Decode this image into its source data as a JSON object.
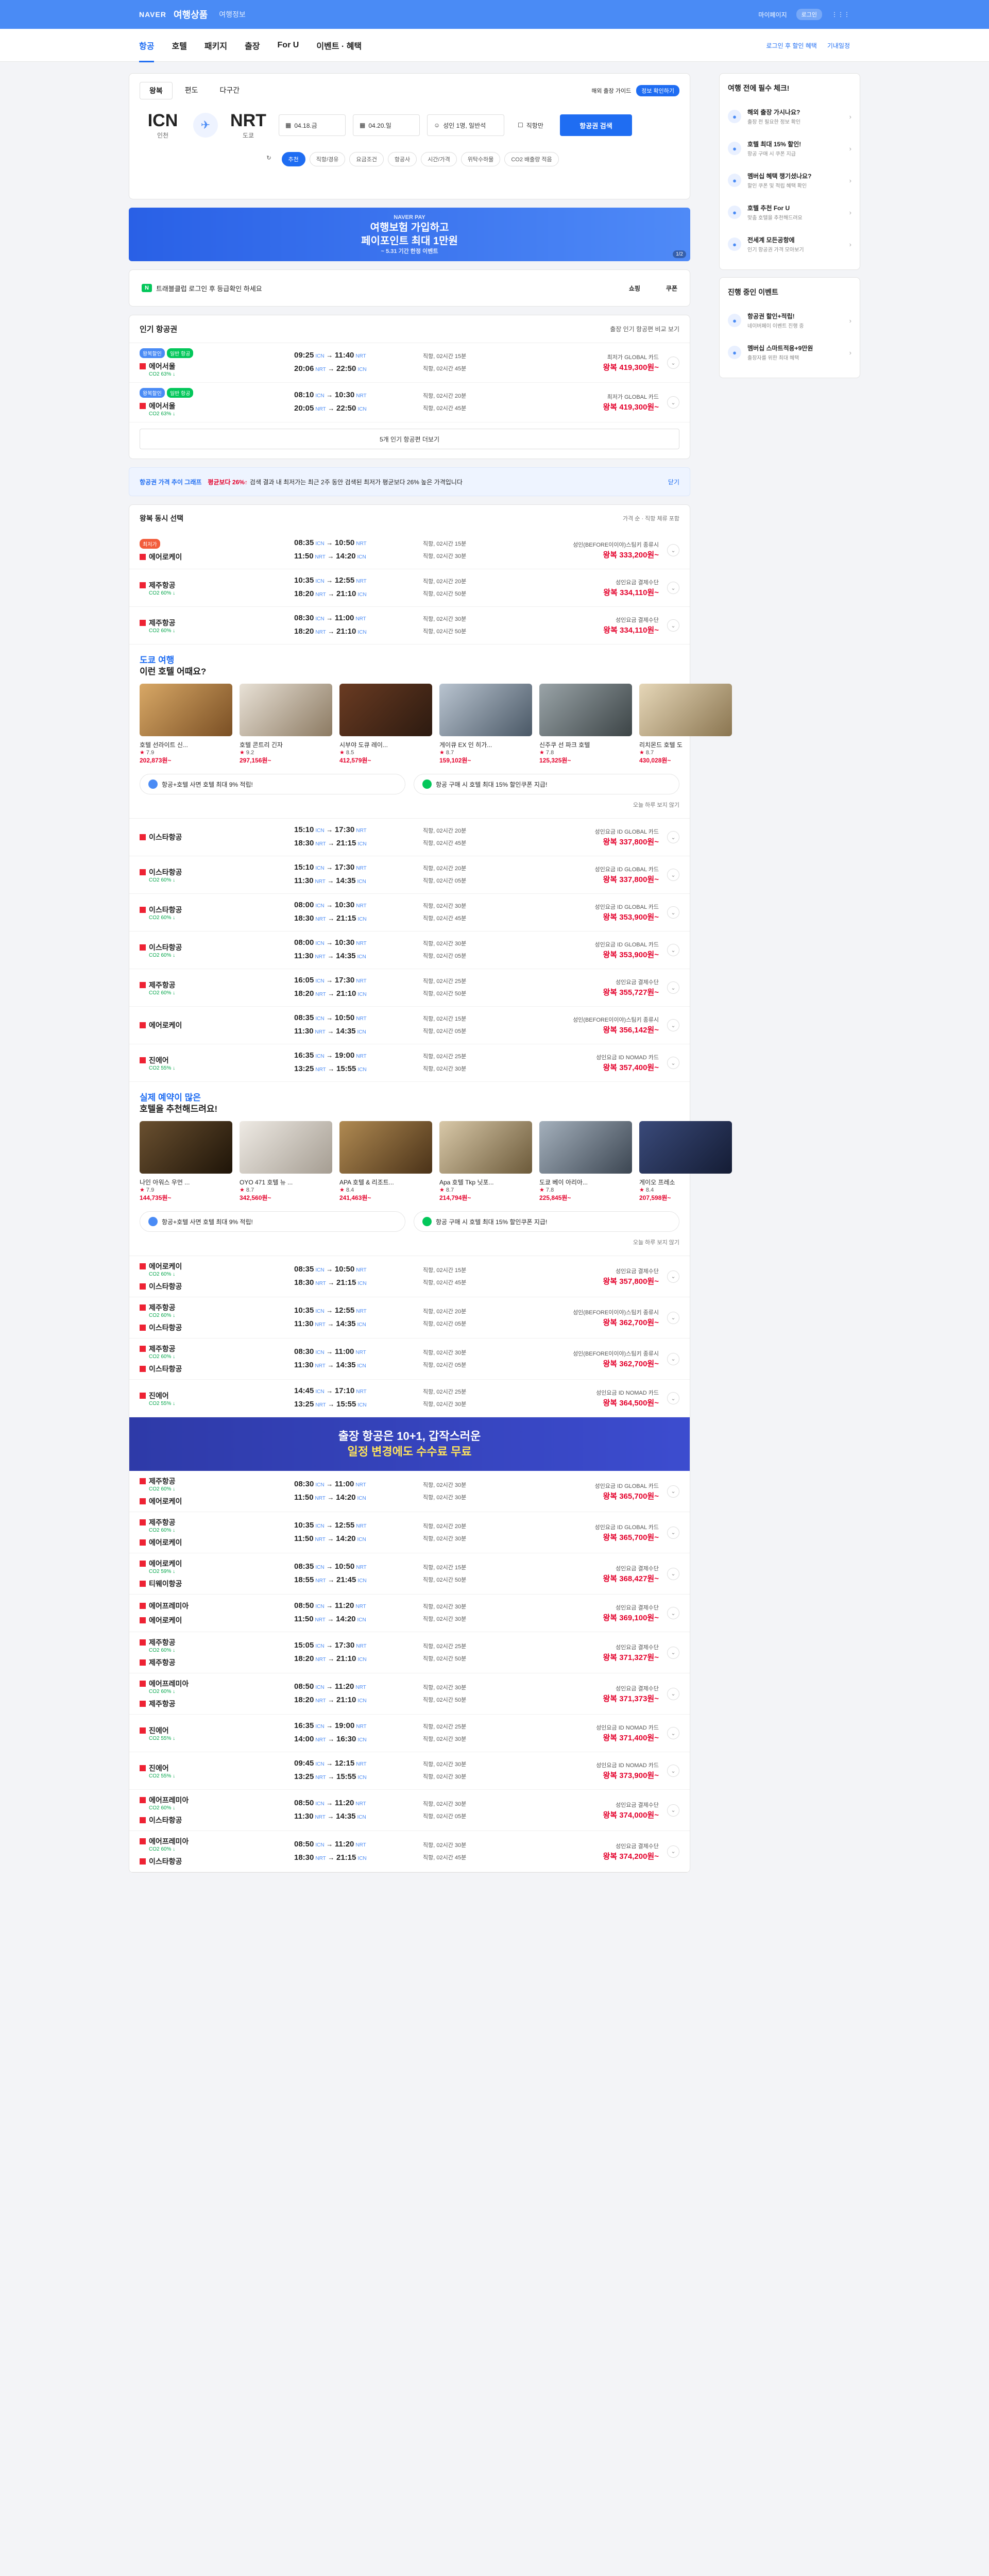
{
  "topbar": {
    "logo": "NAVER",
    "brand": "여행상품",
    "sub": "여행정보",
    "mypage": "마이페이지",
    "pill": "로그인"
  },
  "nav": {
    "tabs": [
      "항공",
      "호텔",
      "패키지",
      "출장",
      "For U",
      "이벤트 · 혜택"
    ],
    "login_note": "로그인 후 할인 혜택",
    "notice": "기내일정"
  },
  "search": {
    "trip_tabs": [
      "왕복",
      "편도",
      "다구간"
    ],
    "overseas": "해외 출장 가이드",
    "overseas_badge": "정보 확인하기",
    "from": {
      "code": "ICN",
      "city": "인천"
    },
    "to": {
      "code": "NRT",
      "city": "도쿄"
    },
    "date1": "04.18.금",
    "date2": "04.20.일",
    "pax": "성인 1명, 일반석",
    "direct": "직항만",
    "button": "항공권 검색",
    "filters": [
      "추천",
      "직항/경유",
      "요금조건",
      "항공사",
      "시간/가격",
      "위탁수하물",
      "CO2 배출량 적음"
    ]
  },
  "banner": {
    "eyebrow": "NAVER PAY",
    "title1": "여행보험 가입하고",
    "title2": "페이포인트 최대 1만원",
    "small": "~ 5.31 기간 한정 이벤트",
    "page": "1/2"
  },
  "promo": {
    "badge": "N",
    "text": "트래블클럽 로그인 후 등급확인 하세요",
    "shop": "쇼핑",
    "coupon": "쿠폰"
  },
  "popular": {
    "title": "인기 항공권",
    "more": "출장 인기 항공편 비교 보기",
    "more_btn": "5개 인기 항공편 더보기"
  },
  "popular_flights": [
    {
      "tags": [
        "왕복할인",
        "일반 항공"
      ],
      "air": "에어서울",
      "co2": "CO2 63% ↓",
      "t1": "09:25",
      "t1e": "11:40",
      "t2": "20:06",
      "t2e": "22:50",
      "d1": "직항, 02시간 15분",
      "d2": "직항, 02시간 45분",
      "seller": "최저가 GLOBAL 카드",
      "price": "왕복 419,300원~"
    },
    {
      "tags": [
        "왕복할인",
        "일반 항공"
      ],
      "air": "에어서울",
      "co2": "CO2 63% ↓",
      "t1": "08:10",
      "t1e": "10:30",
      "t2": "20:05",
      "t2e": "22:50",
      "d1": "직항, 02시간 20분",
      "d2": "직항, 02시간 45분",
      "seller": "최저가 GLOBAL 카드",
      "price": "왕복 419,300원~"
    }
  ],
  "notice": {
    "title": "항공권 가격 추이 그래프",
    "up": "평균보다 26%↑",
    "text": "검색 결과 내 최저가는 최근 2주 동안 검색된 최저가 평균보다 26% 높은 가격입니다",
    "btn": "닫기"
  },
  "sort": {
    "title": "왕복 동시 선택",
    "right": "가격 순 · 직항 체류 포함"
  },
  "flights_a": [
    {
      "best": "최저가",
      "air": "에어로케이",
      "air2": "",
      "co2": "",
      "t1": "08:35",
      "t1e": "10:50",
      "t2": "11:50",
      "t2e": "14:20",
      "d1": "직항, 02시간 15분",
      "d2": "직항, 02시간 30분",
      "seller": "성인(BEFORE이이야)스팀키 종류시",
      "price": "왕복 333,200원~"
    },
    {
      "best": "",
      "air": "제주항공",
      "air2": "",
      "co2": "CO2 60% ↓",
      "t1": "10:35",
      "t1e": "12:55",
      "t2": "18:20",
      "t2e": "21:10",
      "d1": "직항, 02시간 20분",
      "d2": "직항, 02시간 50분",
      "seller": "성인요금 결제수단",
      "price": "왕복 334,110원~"
    },
    {
      "best": "",
      "air": "제주항공",
      "air2": "",
      "co2": "CO2 60% ↓",
      "t1": "08:30",
      "t1e": "11:00",
      "t2": "18:20",
      "t2e": "21:10",
      "d1": "직항, 02시간 30분",
      "d2": "직항, 02시간 50분",
      "seller": "성인요금 결제수단",
      "price": "왕복 334,110원~"
    }
  ],
  "hotels1": {
    "title1": "도쿄 여행",
    "title2": "이런 호텔 어때요?",
    "items": [
      {
        "name": "호텔 선라이트 신...",
        "rating": "7.9",
        "price": "202,873원~"
      },
      {
        "name": "호텔 콘트리 긴자",
        "rating": "9.2",
        "price": "297,156원~"
      },
      {
        "name": "시부야 도큐 레이...",
        "rating": "8.5",
        "price": "412,579원~"
      },
      {
        "name": "게이큐 EX 인 히가...",
        "rating": "8.7",
        "price": "159,102원~"
      },
      {
        "name": "신주쿠 선 파크 호텔",
        "rating": "7.8",
        "price": "125,325원~"
      },
      {
        "name": "리치몬드 호텔 도",
        "rating": "8.7",
        "price": "430,028원~"
      }
    ]
  },
  "hbanner": {
    "b1": "항공+호텔 사면 호텔 최대 9% 적립!",
    "b2": "항공 구매 시 호텔 최대 15% 할인쿠폰 지급!",
    "hide": "오늘 하루 보지 않기"
  },
  "flights_b": [
    {
      "air": "이스타항공",
      "co2": "",
      "t1": "15:10",
      "t1e": "17:30",
      "t2": "18:30",
      "t2e": "21:15",
      "d1": "직항, 02시간 20분",
      "d2": "직항, 02시간 45분",
      "seller": "성인요금 ID GLOBAL 카드",
      "price": "왕복 337,800원~"
    },
    {
      "air": "이스타항공",
      "co2": "CO2 60% ↓",
      "t1": "15:10",
      "t1e": "17:30",
      "t2": "11:30",
      "t2e": "14:35",
      "d1": "직항, 02시간 20분",
      "d2": "직항, 02시간 05분",
      "seller": "성인요금 ID GLOBAL 카드",
      "price": "왕복 337,800원~"
    },
    {
      "air": "이스타항공",
      "co2": "CO2 60% ↓",
      "t1": "08:00",
      "t1e": "10:30",
      "t2": "18:30",
      "t2e": "21:15",
      "d1": "직항, 02시간 30분",
      "d2": "직항, 02시간 45분",
      "seller": "성인요금 ID GLOBAL 카드",
      "price": "왕복 353,900원~"
    },
    {
      "air": "이스타항공",
      "co2": "CO2 60% ↓",
      "t1": "08:00",
      "t1e": "10:30",
      "t2": "11:30",
      "t2e": "14:35",
      "d1": "직항, 02시간 30분",
      "d2": "직항, 02시간 05분",
      "seller": "성인요금 ID GLOBAL 카드",
      "price": "왕복 353,900원~"
    },
    {
      "air": "제주항공",
      "co2": "CO2 60% ↓",
      "t1": "16:05",
      "t1e": "17:30",
      "t2": "18:20",
      "t2e": "21:10",
      "d1": "직항, 02시간 25분",
      "d2": "직항, 02시간 50분",
      "seller": "성인요금 결제수단",
      "price": "왕복 355,727원~"
    },
    {
      "air": "에어로케이",
      "co2": "",
      "t1": "08:35",
      "t1e": "10:50",
      "t2": "11:30",
      "t2e": "14:35",
      "d1": "직항, 02시간 15분",
      "d2": "직항, 02시간 05분",
      "seller": "성인(BEFORE이이야)스팀키 종류시",
      "price": "왕복 356,142원~"
    },
    {
      "air": "진에어",
      "co2": "CO2 55% ↓",
      "t1": "16:35",
      "t1e": "19:00",
      "t2": "13:25",
      "t2e": "15:55",
      "d1": "직항, 02시간 25분",
      "d2": "직항, 02시간 30분",
      "seller": "성인요금 ID NOMAD 카드",
      "price": "왕복 357,400원~"
    }
  ],
  "hotels2": {
    "title1": "실제 예약이 많은",
    "title2": "호텔을 추천해드려요!",
    "items": [
      {
        "name": "나인 아워스 우먼 ...",
        "rating": "7.9",
        "price": "144,735원~"
      },
      {
        "name": "OYO 471 호텔 뉴 ...",
        "rating": "8.7",
        "price": "342,560원~"
      },
      {
        "name": "APA 호텔 & 리조트...",
        "rating": "8.4",
        "price": "241,463원~"
      },
      {
        "name": "Apa 호텔 Tkp 닛포...",
        "rating": "8.7",
        "price": "214,794원~"
      },
      {
        "name": "도쿄 베이 아리아...",
        "rating": "7.8",
        "price": "225,845원~"
      },
      {
        "name": "게이오 프레소",
        "rating": "8.4",
        "price": "207,598원~"
      }
    ]
  },
  "flights_c": [
    {
      "air": "에어로케이",
      "air2": "이스타항공",
      "co2": "CO2 60% ↓",
      "t1": "08:35",
      "t1e": "10:50",
      "t2": "18:30",
      "t2e": "21:15",
      "d1": "직항, 02시간 15분",
      "d2": "직항, 02시간 45분",
      "seller": "성인요금 결제수단",
      "price": "왕복 357,800원~"
    },
    {
      "air": "제주항공",
      "air2": "이스타항공",
      "co2": "CO2 60% ↓",
      "t1": "10:35",
      "t1e": "12:55",
      "t2": "11:30",
      "t2e": "14:35",
      "d1": "직항, 02시간 20분",
      "d2": "직항, 02시간 05분",
      "seller": "성인(BEFORE이이야)스팀키 종류시",
      "price": "왕복 362,700원~"
    },
    {
      "air": "제주항공",
      "air2": "이스타항공",
      "co2": "CO2 60% ↓",
      "t1": "08:30",
      "t1e": "11:00",
      "t2": "11:30",
      "t2e": "14:35",
      "d1": "직항, 02시간 30분",
      "d2": "직항, 02시간 05분",
      "seller": "성인(BEFORE이이야)스팀키 종류시",
      "price": "왕복 362,700원~"
    },
    {
      "air": "진에어",
      "air2": "",
      "co2": "CO2 55% ↓",
      "t1": "14:45",
      "t1e": "17:10",
      "t2": "13:25",
      "t2e": "15:55",
      "d1": "직항, 02시간 25분",
      "d2": "직항, 02시간 30분",
      "seller": "성인요금 ID NOMAD 카드",
      "price": "왕복 364,500원~"
    }
  ],
  "ad": {
    "line1": "출장 항공은 10+1, 갑작스러운",
    "line2": "일정 변경에도 수수료 무료"
  },
  "flights_d": [
    {
      "air": "제주항공",
      "air2": "에어로케이",
      "co2": "CO2 60% ↓",
      "t1": "08:30",
      "t1e": "11:00",
      "t2": "11:50",
      "t2e": "14:20",
      "d1": "직항, 02시간 30분",
      "d2": "직항, 02시간 30분",
      "seller": "성인요금 ID GLOBAL 카드",
      "price": "왕복 365,700원~"
    },
    {
      "air": "제주항공",
      "air2": "에어로케이",
      "co2": "CO2 60% ↓",
      "t1": "10:35",
      "t1e": "12:55",
      "t2": "11:50",
      "t2e": "14:20",
      "d1": "직항, 02시간 20분",
      "d2": "직항, 02시간 30분",
      "seller": "성인요금 ID GLOBAL 카드",
      "price": "왕복 365,700원~"
    },
    {
      "air": "에어로케이",
      "air2": "티웨이항공",
      "co2": "CO2 59% ↓",
      "t1": "08:35",
      "t1e": "10:50",
      "t2": "18:55",
      "t2e": "21:45",
      "d1": "직항, 02시간 15분",
      "d2": "직항, 02시간 50분",
      "seller": "성인요금 결제수단",
      "price": "왕복 368,427원~"
    },
    {
      "air": "에어프레미아",
      "air2": "에어로케이",
      "co2": "",
      "t1": "08:50",
      "t1e": "11:20",
      "t2": "11:50",
      "t2e": "14:20",
      "d1": "직항, 02시간 30분",
      "d2": "직항, 02시간 30분",
      "seller": "성인요금 결제수단",
      "price": "왕복 369,100원~"
    },
    {
      "air": "제주항공",
      "air2": "제주항공",
      "co2": "CO2 60% ↓",
      "t1": "15:05",
      "t1e": "17:30",
      "t2": "18:20",
      "t2e": "21:10",
      "d1": "직항, 02시간 25분",
      "d2": "직항, 02시간 50분",
      "seller": "성인요금 결제수단",
      "price": "왕복 371,327원~"
    },
    {
      "air": "에어프레미아",
      "air2": "제주항공",
      "co2": "CO2 60% ↓",
      "t1": "08:50",
      "t1e": "11:20",
      "t2": "18:20",
      "t2e": "21:10",
      "d1": "직항, 02시간 30분",
      "d2": "직항, 02시간 50분",
      "seller": "성인요금 결제수단",
      "price": "왕복 371,373원~"
    },
    {
      "air": "진에어",
      "air2": "",
      "co2": "CO2 55% ↓",
      "t1": "16:35",
      "t1e": "19:00",
      "t2": "14:00",
      "t2e": "16:30",
      "d1": "직항, 02시간 25분",
      "d2": "직항, 02시간 30분",
      "seller": "성인요금 ID NOMAD 카드",
      "price": "왕복 371,400원~"
    },
    {
      "air": "진에어",
      "air2": "",
      "co2": "CO2 55% ↓",
      "t1": "09:45",
      "t1e": "12:15",
      "t2": "13:25",
      "t2e": "15:55",
      "d1": "직항, 02시간 30분",
      "d2": "직항, 02시간 30분",
      "seller": "성인요금 ID NOMAD 카드",
      "price": "왕복 373,900원~"
    },
    {
      "air": "에어프레미아",
      "air2": "이스타항공",
      "co2": "CO2 60% ↓",
      "t1": "08:50",
      "t1e": "11:20",
      "t2": "11:30",
      "t2e": "14:35",
      "d1": "직항, 02시간 30분",
      "d2": "직항, 02시간 05분",
      "seller": "성인요금 결제수단",
      "price": "왕복 374,000원~"
    },
    {
      "air": "에어프레미아",
      "air2": "이스타항공",
      "co2": "CO2 60% ↓",
      "t1": "08:50",
      "t1e": "11:20",
      "t2": "18:30",
      "t2e": "21:15",
      "d1": "직항, 02시간 30분",
      "d2": "직항, 02시간 45분",
      "seller": "성인요금 결제수단",
      "price": "왕복 374,200원~"
    }
  ],
  "side1": {
    "title": "여행 전에 필수 체크!",
    "items": [
      {
        "t": "해외 출장 가시나요?",
        "s": "출장 전 필요한 정보 확인"
      },
      {
        "t": "호텔 최대 15% 할인!",
        "s": "항공 구매 시 쿠폰 지급"
      },
      {
        "t": "멤버십 혜택 챙기셨나요?",
        "s": "할인 쿠폰 및 적립 혜택 확인"
      },
      {
        "t": "호텔 추천 For U",
        "s": "맞춤 호텔을 추천해드려요"
      },
      {
        "t": "전세계 모든공항에",
        "s": "인기 항공권 가격 모아보기"
      }
    ]
  },
  "side2": {
    "title": "진행 중인 이벤트",
    "items": [
      {
        "t": "항공권 할인+적립!",
        "s": "네이버페이 이벤트 진행 중"
      },
      {
        "t": "멤버십 스마트적용+9만원",
        "s": "출장자를 위한 최대 혜택"
      }
    ]
  }
}
